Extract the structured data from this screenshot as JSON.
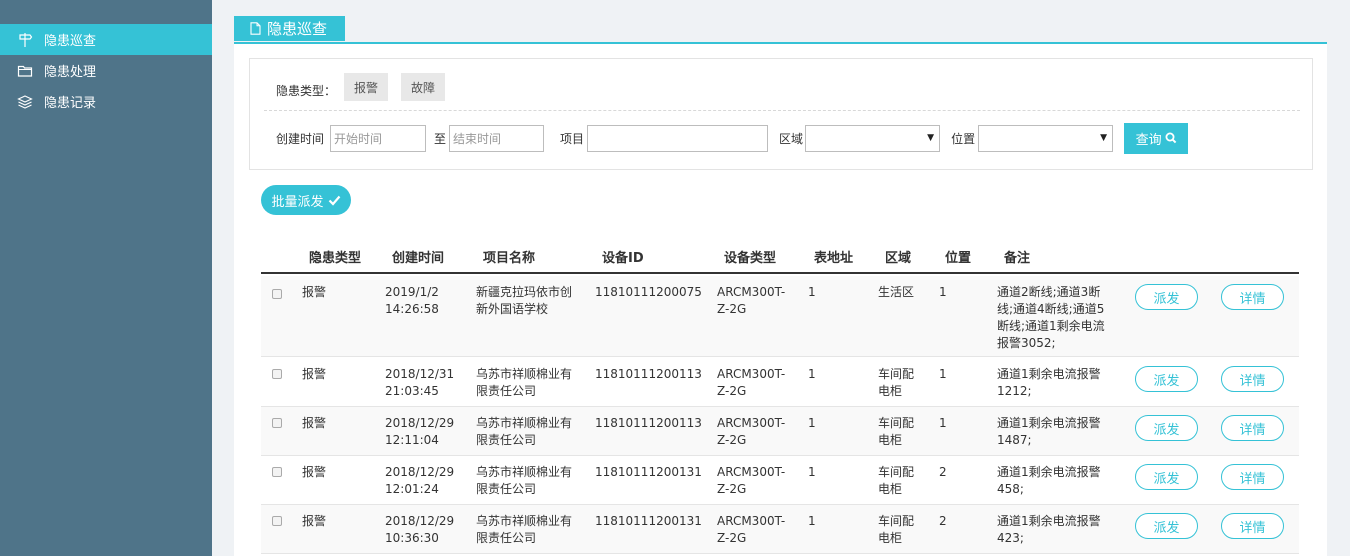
{
  "sidebar": {
    "items": [
      {
        "label": "隐患巡查",
        "icon": "signpost-icon"
      },
      {
        "label": "隐患处理",
        "icon": "folder-icon"
      },
      {
        "label": "隐患记录",
        "icon": "layers-icon"
      }
    ]
  },
  "page": {
    "tab_label": "隐患巡查"
  },
  "filter": {
    "type_label": "隐患类型：",
    "types": [
      "报警",
      "故障"
    ],
    "created_label": "创建时间",
    "start_placeholder": "开始时间",
    "to_label": "至",
    "end_placeholder": "结束时间",
    "project_label": "项目",
    "area_label": "区域",
    "position_label": "位置",
    "query_label": "查询"
  },
  "batch_label": "批量派发",
  "table": {
    "headers": [
      "隐患类型",
      "创建时间",
      "项目名称",
      "设备ID",
      "设备类型",
      "表地址",
      "区域",
      "位置",
      "备注"
    ],
    "dispatch_label": "派发",
    "detail_label": "详情",
    "rows": [
      {
        "type": "报警",
        "time1": "2019/1/2",
        "time2": "14:26:58",
        "proj1": "新疆克拉玛依市创",
        "proj2": "新外国语学校",
        "id": "11810111200075",
        "dev1": "ARCM300T-",
        "dev2": "Z-2G",
        "addr": "1",
        "area1": "生活区",
        "area2": "",
        "pos": "1",
        "note1": "通道2断线;通道3断",
        "note2": "线;通道4断线;通道5",
        "note3": "断线;通道1剩余电流",
        "note4": "报警3052;"
      },
      {
        "type": "报警",
        "time1": "2018/12/31",
        "time2": "21:03:45",
        "proj1": "乌苏市祥顺棉业有",
        "proj2": "限责任公司",
        "id": "11810111200113",
        "dev1": "ARCM300T-",
        "dev2": "Z-2G",
        "addr": "1",
        "area1": "车间配",
        "area2": "电柜",
        "pos": "1",
        "note1": "通道1剩余电流报警",
        "note2": "1212;",
        "note3": "",
        "note4": ""
      },
      {
        "type": "报警",
        "time1": "2018/12/29",
        "time2": "12:11:04",
        "proj1": "乌苏市祥顺棉业有",
        "proj2": "限责任公司",
        "id": "11810111200113",
        "dev1": "ARCM300T-",
        "dev2": "Z-2G",
        "addr": "1",
        "area1": "车间配",
        "area2": "电柜",
        "pos": "1",
        "note1": "通道1剩余电流报警",
        "note2": "1487;",
        "note3": "",
        "note4": ""
      },
      {
        "type": "报警",
        "time1": "2018/12/29",
        "time2": "12:01:24",
        "proj1": "乌苏市祥顺棉业有",
        "proj2": "限责任公司",
        "id": "11810111200131",
        "dev1": "ARCM300T-",
        "dev2": "Z-2G",
        "addr": "1",
        "area1": "车间配",
        "area2": "电柜",
        "pos": "2",
        "note1": "通道1剩余电流报警",
        "note2": "458;",
        "note3": "",
        "note4": ""
      },
      {
        "type": "报警",
        "time1": "2018/12/29",
        "time2": "10:36:30",
        "proj1": "乌苏市祥顺棉业有",
        "proj2": "限责任公司",
        "id": "11810111200131",
        "dev1": "ARCM300T-",
        "dev2": "Z-2G",
        "addr": "1",
        "area1": "车间配",
        "area2": "电柜",
        "pos": "2",
        "note1": "通道1剩余电流报警",
        "note2": "423;",
        "note3": "",
        "note4": ""
      }
    ]
  },
  "colors": {
    "accent": "#35c2d6",
    "sidebar": "#4f7489",
    "background": "#eff2f5"
  }
}
